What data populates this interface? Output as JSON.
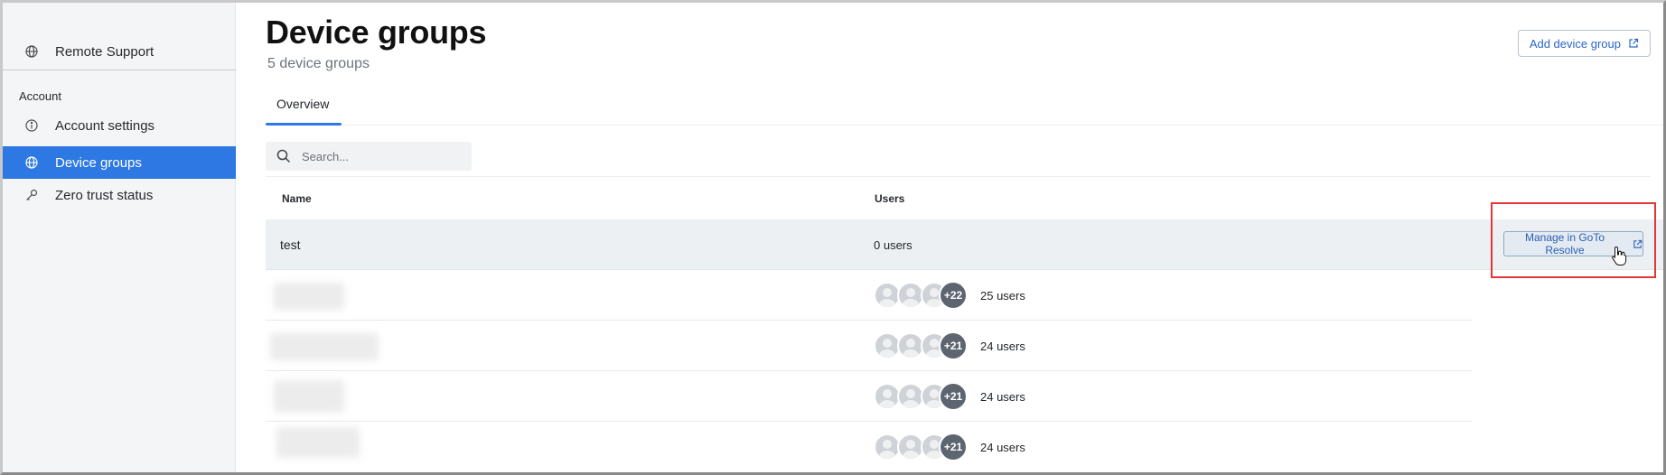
{
  "sidebar": {
    "items_top": [
      {
        "label": "Remote Support",
        "icon": "globe-icon"
      }
    ],
    "section_label": "Account",
    "items": [
      {
        "label": "Account settings",
        "icon": "info-icon",
        "active": false
      },
      {
        "label": "Device groups",
        "icon": "globe-icon",
        "active": true
      },
      {
        "label": "Zero trust status",
        "icon": "key-icon",
        "active": false
      }
    ]
  },
  "header": {
    "title": "Device groups",
    "subtitle": "5 device groups",
    "add_button_label": "Add device group",
    "add_button_icon": "external-link-icon"
  },
  "tabs": [
    {
      "label": "Overview",
      "active": true
    }
  ],
  "search": {
    "placeholder": "Search...",
    "value": "",
    "icon": "search-icon"
  },
  "table": {
    "columns": [
      "Name",
      "Users"
    ],
    "rows": [
      {
        "name": "test",
        "name_redacted": false,
        "avatars": 0,
        "extra_users": "",
        "users": "0 users",
        "highlighted": true
      },
      {
        "name": "",
        "name_redacted": true,
        "avatars": 3,
        "extra_users": "+22",
        "users": "25 users",
        "highlighted": false
      },
      {
        "name": "",
        "name_redacted": true,
        "avatars": 3,
        "extra_users": "+21",
        "users": "24 users",
        "highlighted": false
      },
      {
        "name": "",
        "name_redacted": true,
        "avatars": 3,
        "extra_users": "+21",
        "users": "24 users",
        "highlighted": false
      },
      {
        "name": "",
        "name_redacted": true,
        "avatars": 3,
        "extra_users": "+21",
        "users": "24 users",
        "highlighted": false
      }
    ],
    "row_action": {
      "label": "Manage in GoTo Resolve",
      "icon": "external-link-icon"
    }
  },
  "colors": {
    "accent": "#2d78e2",
    "highlight_border": "#e2363a",
    "row_highlight": "#edf0f3"
  }
}
